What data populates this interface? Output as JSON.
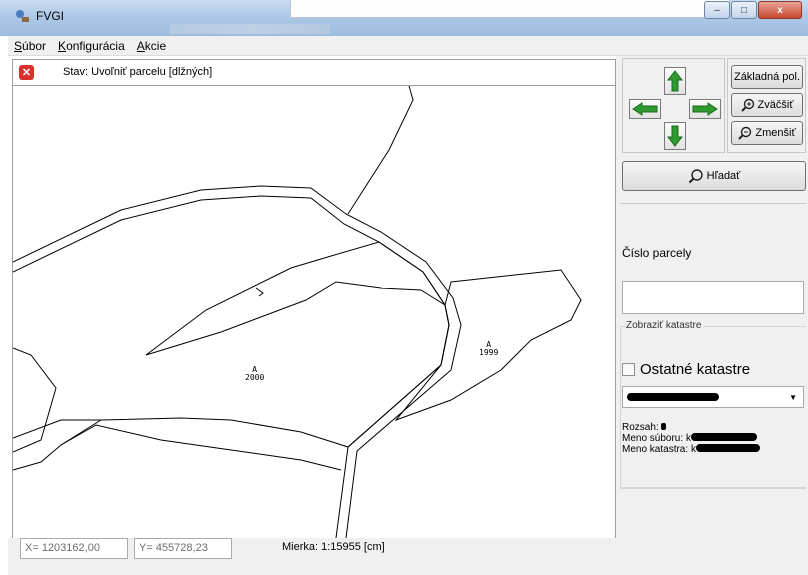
{
  "window": {
    "title": "FVGI",
    "colors": {
      "titlebar": "#aec8e6",
      "close": "#c9472e"
    },
    "buttons": {
      "minimize": "–",
      "maximize": "□",
      "close": "x"
    }
  },
  "menu": [
    {
      "underline": "S",
      "rest": "úbor"
    },
    {
      "underline": "K",
      "rest": "onfigurácia"
    },
    {
      "underline": "A",
      "rest": "kcie"
    }
  ],
  "status": {
    "icon": "error-icon",
    "text": "Stav: Uvoľniť parcelu [dlžných]"
  },
  "map": {
    "parcel_labels": [
      {
        "mark": "A",
        "number": "2000"
      },
      {
        "mark": "A",
        "number": "1999"
      }
    ]
  },
  "coords": {
    "x": "X= 1203162,00",
    "y": "Y= 455728,23",
    "scale": "Mierka:  1:15955  [cm]"
  },
  "panel": {
    "nav_icons": [
      "arrow-up-icon",
      "arrow-left-icon",
      "arrow-right-icon",
      "arrow-down-icon"
    ],
    "zoom_buttons": {
      "home": "Základná pol.",
      "zoom_in": "Zväčšiť",
      "zoom_out": "Zmenšiť"
    },
    "search_label": "Hľadať",
    "parcel_label": "Číslo parcely",
    "parcel_value": "",
    "group_title": "Zobraziť katastre",
    "other_cadastre_label": "Ostatné katastre",
    "other_cadastre_checked": false,
    "range_label": "Rozsah:",
    "file_label": "Meno súboru:",
    "file_prefix": "k",
    "cadastre_label": "Meno katastra:",
    "cadastre_prefix": "k"
  }
}
